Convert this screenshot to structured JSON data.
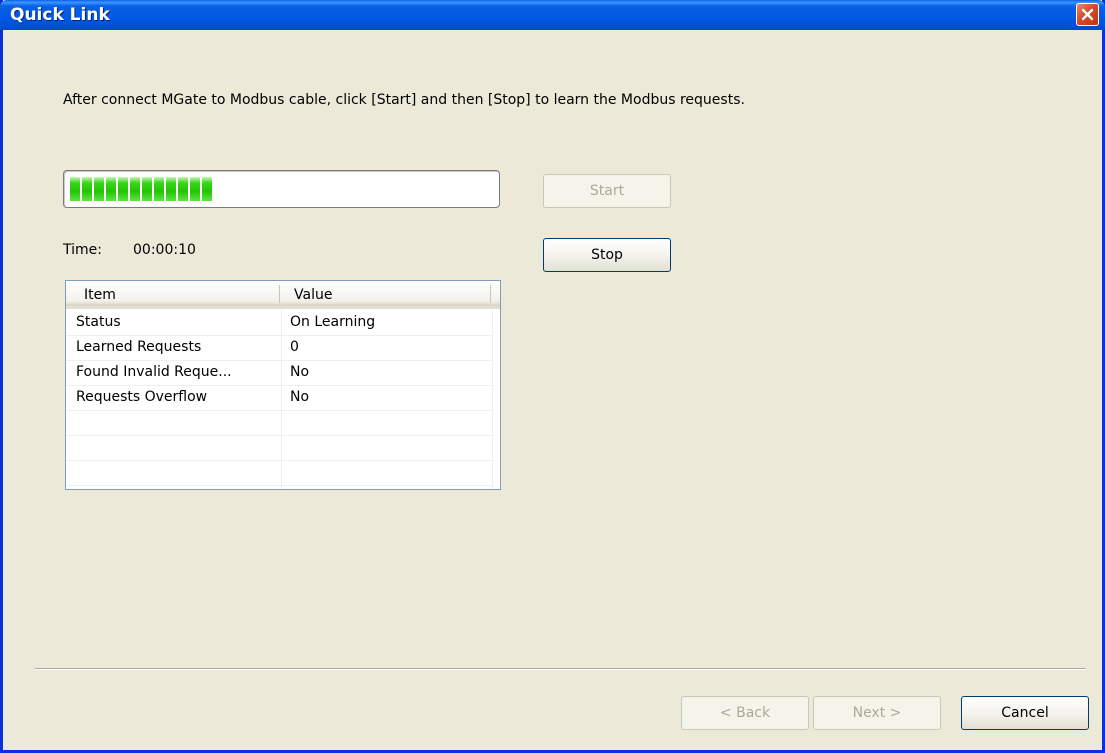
{
  "window": {
    "title": "Quick Link",
    "close_icon": "close-icon"
  },
  "instruction": "After connect MGate to Modbus cable, click [Start] and then [Stop] to learn the Modbus requests.",
  "progress": {
    "segments_filled": 12,
    "fill_color": "#24c404"
  },
  "buttons": {
    "start": "Start",
    "stop": "Stop",
    "back": "< Back",
    "next": "Next >",
    "cancel": "Cancel"
  },
  "time": {
    "label": "Time:",
    "value": "00:00:10"
  },
  "table": {
    "headers": [
      "Item",
      "Value"
    ],
    "rows": [
      [
        "Status",
        "On Learning"
      ],
      [
        "Learned Requests",
        "0"
      ],
      [
        "Found Invalid Reque...",
        "No"
      ],
      [
        "Requests Overflow",
        "No"
      ]
    ]
  }
}
